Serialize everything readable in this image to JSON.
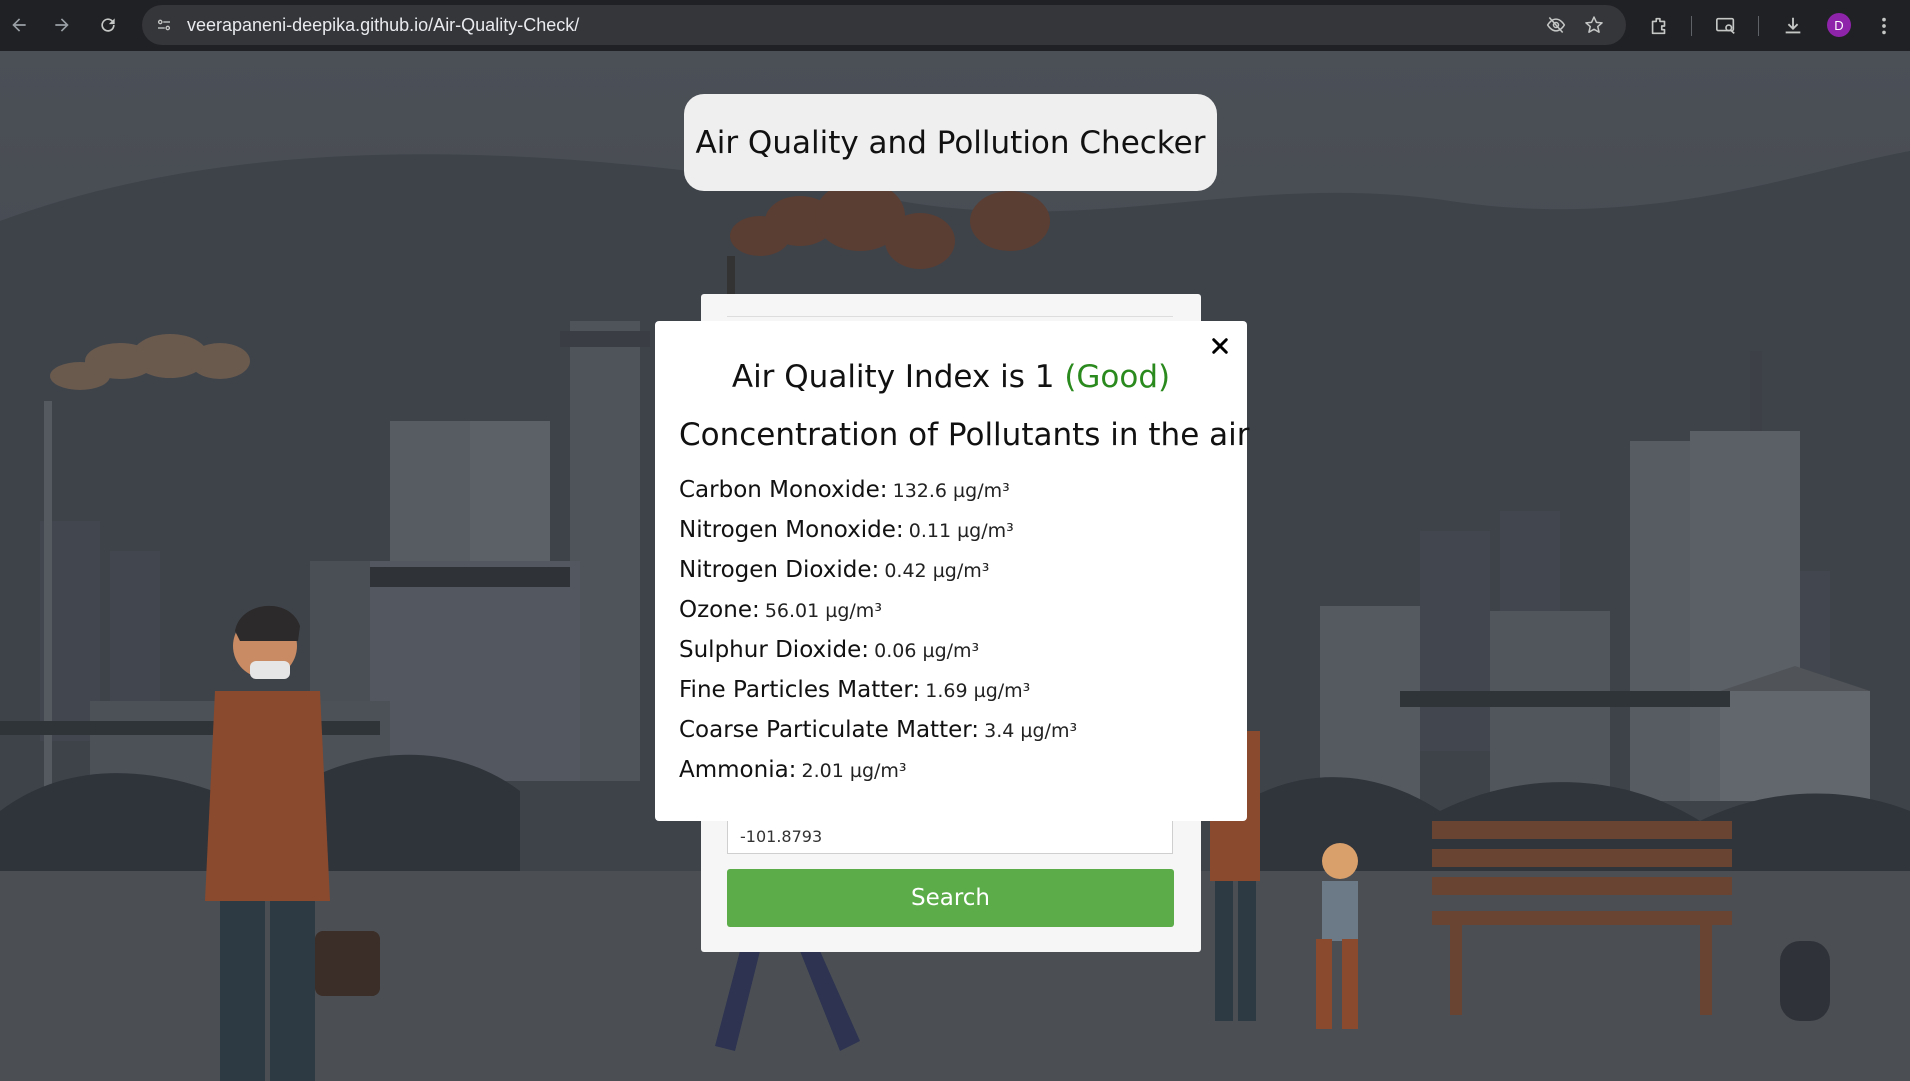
{
  "browser": {
    "url": "veerapaneni-deepika.github.io/Air-Quality-Check/",
    "profile_initial": "D",
    "icons": [
      "back-arrow-icon",
      "forward-arrow-icon",
      "reload-icon",
      "site-info-icon",
      "eye-off-icon",
      "bookmark-star-icon",
      "extensions-icon",
      "cast-search-icon",
      "download-icon",
      "kebab-menu-icon"
    ]
  },
  "page": {
    "title": "Air Quality and Pollution Checker",
    "longitude_value": "-101.8793",
    "search_label": "Search"
  },
  "modal": {
    "aqi_prefix": "Air Quality Index is 1",
    "aqi_status": "(Good)",
    "heading": "Concentration of Pollutants in the air",
    "pollutants": [
      {
        "name": "Carbon Monoxide:",
        "value": "132.6 µg/m³"
      },
      {
        "name": "Nitrogen Monoxide:",
        "value": "0.11 µg/m³"
      },
      {
        "name": "Nitrogen Dioxide:",
        "value": "0.42 µg/m³"
      },
      {
        "name": "Ozone:",
        "value": "56.01 µg/m³"
      },
      {
        "name": "Sulphur Dioxide:",
        "value": "0.06 µg/m³"
      },
      {
        "name": "Fine Particles Matter:",
        "value": "1.69 µg/m³"
      },
      {
        "name": "Coarse Particulate Matter:",
        "value": "3.4 µg/m³"
      },
      {
        "name": "Ammonia:",
        "value": "2.01 µg/m³"
      }
    ]
  },
  "colors": {
    "good_status": "#2b8a1e",
    "search_button": "#5cad4a",
    "chrome_bg": "#202124",
    "avatar": "#8e24aa"
  }
}
